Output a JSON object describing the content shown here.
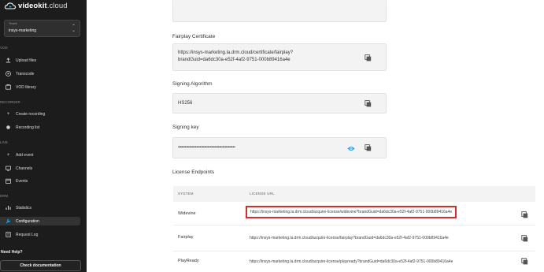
{
  "brand": {
    "name_bold": "videokit",
    "name_light": ".cloud"
  },
  "tenant": {
    "label": "Tenant",
    "value": "insys-marketing"
  },
  "sidebar": {
    "sections": [
      {
        "label": "VOD"
      },
      {
        "label": "RECORDER"
      },
      {
        "label": "LIVE"
      },
      {
        "label": "DRM"
      }
    ],
    "items": [
      {
        "label": "Upload files",
        "icon": "upload-icon"
      },
      {
        "label": "Transcode",
        "icon": "play-circle-icon"
      },
      {
        "label": "VOD library",
        "icon": "library-icon"
      },
      {
        "label": "Create recording",
        "icon": "plus-icon"
      },
      {
        "label": "Recording list",
        "icon": "record-icon"
      },
      {
        "label": "Add event",
        "icon": "plus-icon"
      },
      {
        "label": "Channels",
        "icon": "monitor-icon"
      },
      {
        "label": "Events",
        "icon": "calendar-icon"
      },
      {
        "label": "Statistics",
        "icon": "chart-icon"
      },
      {
        "label": "Configuration",
        "icon": "wrench-icon",
        "active": true
      },
      {
        "label": "Request Log",
        "icon": "log-icon"
      }
    ],
    "help_title": "Need Help?",
    "doc_button": "Check documentation"
  },
  "fields": {
    "fairplay_cert": {
      "label": "Fairplay Certificate",
      "line1": "https://insys-marketing.la.drm.cloud/certificate/fairplay?",
      "line2": "brandGuid=da6dc30a-e52f-4af2-9751-000b89416a4e"
    },
    "signing_algorithm": {
      "label": "Signing Algorithm",
      "value": "HS256"
    },
    "signing_key": {
      "label": "Signing key",
      "value": "••••••••••••••••••••••••••••••••••••••••••••••••••"
    }
  },
  "license": {
    "title": "License Endpoints",
    "headers": {
      "system": "SYSTEM",
      "url": "LICENSE URL"
    },
    "rows": [
      {
        "system": "Widevine",
        "url": "https://insys-marketing.la.drm.cloud/acquire-license/widevine?brandGuid=da6dc30a-e52f-4af2-9751-000b89416a4e",
        "highlighted": true
      },
      {
        "system": "Fairplay",
        "url": "https://insys-marketing.la.drm.cloud/acquire-license/fairplay?brandGuid=da6dc30a-e52f-4af2-9751-000b89416a4e"
      },
      {
        "system": "PlayReady",
        "url": "https://insys-marketing.la.drm.cloud/acquire-license/playready?brandGuid=da6dc30a-e52f-4af2-9751-000b89416a4e"
      }
    ]
  },
  "colors": {
    "accent": "#2ea3e6",
    "highlight_border": "#d32f2f",
    "sidebar_bg": "#1c1c1c"
  }
}
